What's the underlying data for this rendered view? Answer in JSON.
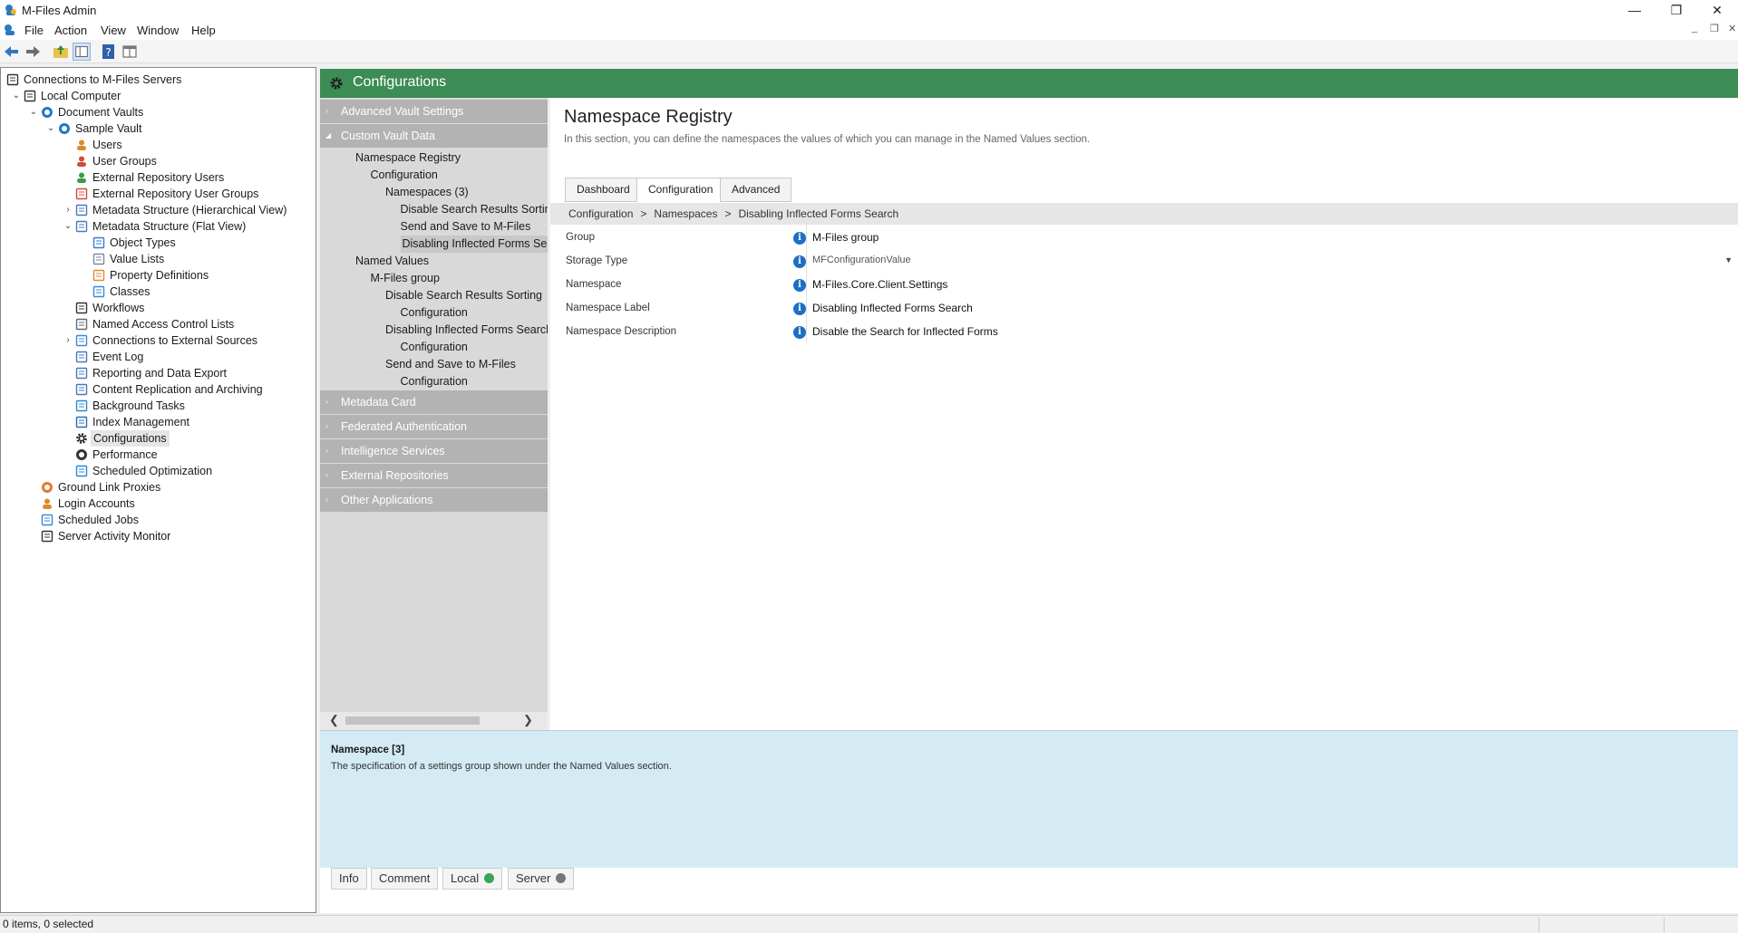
{
  "window": {
    "title": "M-Files Admin",
    "controls": [
      "—",
      "❐",
      "✕"
    ]
  },
  "menu": {
    "items": [
      "File",
      "Action",
      "View",
      "Window",
      "Help"
    ],
    "mdi_controls": [
      "_",
      "❐",
      "✕"
    ]
  },
  "tree": {
    "items": [
      {
        "label": "Connections to M-Files Servers",
        "twisty": "",
        "icon": "servers-icon",
        "level": 0
      },
      {
        "label": "Local Computer",
        "twisty": "⌄",
        "icon": "computer-icon",
        "level": 1
      },
      {
        "label": "Document Vaults",
        "twisty": "⌄",
        "icon": "vaults-icon",
        "level": 2
      },
      {
        "label": "Sample Vault",
        "twisty": "⌄",
        "icon": "vault-icon",
        "level": 3
      },
      {
        "label": "Users",
        "twisty": "",
        "icon": "user-icon",
        "level": 4
      },
      {
        "label": "User Groups",
        "twisty": "",
        "icon": "user-groups-icon",
        "level": 4
      },
      {
        "label": "External Repository Users",
        "twisty": "",
        "icon": "external-user-icon",
        "level": 4
      },
      {
        "label": "External Repository User Groups",
        "twisty": "",
        "icon": "external-groups-icon",
        "level": 4
      },
      {
        "label": "Metadata Structure (Hierarchical View)",
        "twisty": "›",
        "icon": "hierarchy-icon",
        "level": 4
      },
      {
        "label": "Metadata Structure (Flat View)",
        "twisty": "⌄",
        "icon": "list-icon",
        "level": 4
      },
      {
        "label": "Object Types",
        "twisty": "",
        "icon": "object-types-icon",
        "level": 5
      },
      {
        "label": "Value Lists",
        "twisty": "",
        "icon": "value-lists-icon",
        "level": 5
      },
      {
        "label": "Property Definitions",
        "twisty": "",
        "icon": "property-icon",
        "level": 5
      },
      {
        "label": "Classes",
        "twisty": "",
        "icon": "classes-icon",
        "level": 5
      },
      {
        "label": "Workflows",
        "twisty": "",
        "icon": "workflow-icon",
        "level": 4
      },
      {
        "label": "Named Access Control Lists",
        "twisty": "",
        "icon": "acl-icon",
        "level": 4
      },
      {
        "label": "Connections to External Sources",
        "twisty": "›",
        "icon": "external-source-icon",
        "level": 4
      },
      {
        "label": "Event Log",
        "twisty": "",
        "icon": "event-log-icon",
        "level": 4
      },
      {
        "label": "Reporting and Data Export",
        "twisty": "",
        "icon": "report-icon",
        "level": 4
      },
      {
        "label": "Content Replication and Archiving",
        "twisty": "",
        "icon": "replication-icon",
        "level": 4
      },
      {
        "label": "Background Tasks",
        "twisty": "",
        "icon": "tasks-icon",
        "level": 4
      },
      {
        "label": "Index Management",
        "twisty": "",
        "icon": "index-icon",
        "level": 4
      },
      {
        "label": "Configurations",
        "twisty": "",
        "icon": "gear-icon",
        "level": 4,
        "selected": true
      },
      {
        "label": "Performance",
        "twisty": "",
        "icon": "performance-icon",
        "level": 4
      },
      {
        "label": "Scheduled Optimization",
        "twisty": "",
        "icon": "optimization-icon",
        "level": 4
      },
      {
        "label": "Ground Link Proxies",
        "twisty": "",
        "icon": "proxy-icon",
        "level": 2
      },
      {
        "label": "Login Accounts",
        "twisty": "",
        "icon": "login-icon",
        "level": 2
      },
      {
        "label": "Scheduled Jobs",
        "twisty": "",
        "icon": "jobs-icon",
        "level": 2
      },
      {
        "label": "Server Activity Monitor",
        "twisty": "",
        "icon": "monitor-icon",
        "level": 2
      }
    ]
  },
  "config": {
    "title": "Configurations",
    "sections_top": [
      {
        "label": "Advanced Vault Settings",
        "arrow": "›"
      },
      {
        "label": "Custom Vault Data",
        "arrow": "◢"
      }
    ],
    "nav": [
      {
        "label": "Namespace Registry",
        "tri": "◢",
        "indent": 1
      },
      {
        "label": "Configuration",
        "tri": "◢",
        "indent": 2
      },
      {
        "label": "Namespaces (3)",
        "tri": "◢",
        "indent": 3
      },
      {
        "label": "Disable Search Results Sorting",
        "tri": "",
        "indent": 4
      },
      {
        "label": "Send and Save to M-Files",
        "tri": "",
        "indent": 4
      },
      {
        "label": "Disabling Inflected Forms Search",
        "tri": "",
        "indent": 4,
        "selected": true
      },
      {
        "label": "Named Values",
        "tri": "◢",
        "indent": 1
      },
      {
        "label": "M-Files group",
        "tri": "◢",
        "indent": 2
      },
      {
        "label": "Disable Search Results Sorting",
        "tri": "◢",
        "indent": 3
      },
      {
        "label": "Configuration",
        "tri": "",
        "indent": 4
      },
      {
        "label": "Disabling Inflected Forms Search",
        "tri": "◢",
        "indent": 3
      },
      {
        "label": "Configuration",
        "tri": "",
        "indent": 4
      },
      {
        "label": "Send and Save to M-Files",
        "tri": "◢",
        "indent": 3
      },
      {
        "label": "Configuration",
        "tri": "",
        "indent": 4
      }
    ],
    "sections_bottom": [
      {
        "label": "Metadata Card",
        "arrow": "›"
      },
      {
        "label": "Federated Authentication",
        "arrow": "›"
      },
      {
        "label": "Intelligence Services",
        "arrow": "›"
      },
      {
        "label": "External Repositories",
        "arrow": "›"
      },
      {
        "label": "Other Applications",
        "arrow": "›"
      }
    ]
  },
  "content": {
    "title": "Namespace Registry",
    "description": "In this section, you can define the namespaces the values of which you can manage in the Named Values section.",
    "tabs": [
      "Dashboard",
      "Configuration",
      "Advanced"
    ],
    "active_tab": "Configuration",
    "breadcrumb": [
      "Configuration",
      "Namespaces",
      "Disabling Inflected Forms Search"
    ],
    "properties": [
      {
        "label": "Group",
        "value": "M-Files group"
      },
      {
        "label": "Storage Type",
        "value": "MFConfigurationValue",
        "dropdown": true
      },
      {
        "label": "Namespace",
        "value": "M-Files.Core.Client.Settings"
      },
      {
        "label": "Namespace Label",
        "value": "Disabling Inflected Forms Search"
      },
      {
        "label": "Namespace Description",
        "value": "Disable the Search for Inflected Forms"
      }
    ]
  },
  "info_panel": {
    "title": "Namespace [3]",
    "text": "The specification of a settings group shown under the Named Values section."
  },
  "bottom_tabs": [
    {
      "label": "Info"
    },
    {
      "label": "Comment"
    },
    {
      "label": "Local",
      "dot": "#3aa35a"
    },
    {
      "label": "Server",
      "dot": "#777777"
    }
  ],
  "status": {
    "text": "0 items, 0 selected"
  },
  "colors": {
    "header_green": "#3c8c55",
    "info_bg": "#d4ebf4",
    "info_icon": "#1c6fc4"
  }
}
